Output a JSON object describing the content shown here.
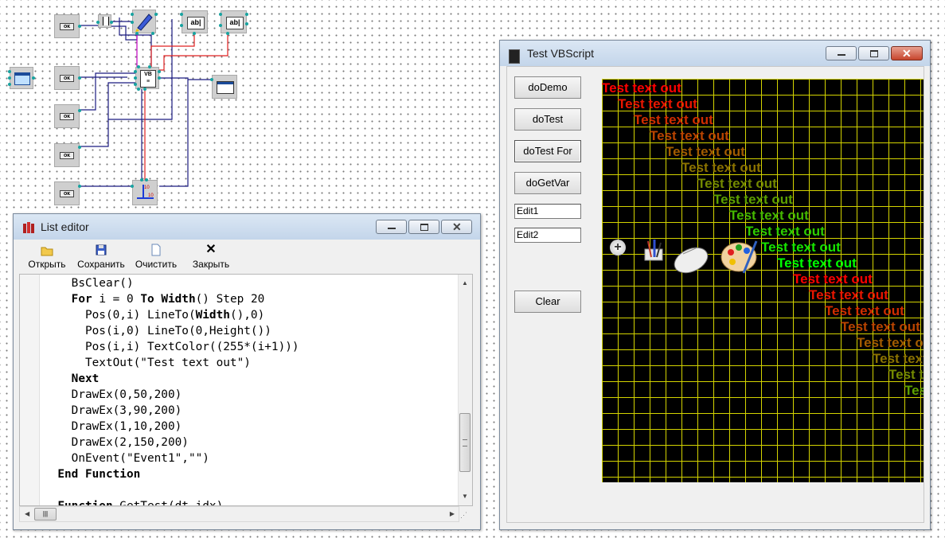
{
  "schematic": {
    "ok_label": "OK",
    "vb_label": "VB"
  },
  "list_editor": {
    "title": "List editor",
    "toolbar": {
      "open": "Открыть",
      "save": "Сохранить",
      "clear": "Очистить",
      "close": "Закрыть"
    },
    "code_lines": [
      {
        "indent": "    ",
        "parts": [
          {
            "t": "BsClear()",
            "b": false
          }
        ]
      },
      {
        "indent": "    ",
        "parts": [
          {
            "t": "For",
            "b": true
          },
          {
            "t": " i = 0 ",
            "b": false
          },
          {
            "t": "To",
            "b": true
          },
          {
            "t": " ",
            "b": false
          },
          {
            "t": "Width",
            "b": true
          },
          {
            "t": "() Step 20",
            "b": false
          }
        ]
      },
      {
        "indent": "      ",
        "parts": [
          {
            "t": "Pos(0,i) LineTo(",
            "b": false
          },
          {
            "t": "Width",
            "b": true
          },
          {
            "t": "(),0)",
            "b": false
          }
        ]
      },
      {
        "indent": "      ",
        "parts": [
          {
            "t": "Pos(i,0) LineTo(0,Height())",
            "b": false
          }
        ]
      },
      {
        "indent": "      ",
        "parts": [
          {
            "t": "Pos(i,i) TextColor((255*(i+1)))",
            "b": false
          }
        ]
      },
      {
        "indent": "      ",
        "parts": [
          {
            "t": "TextOut(\"Test text out\")",
            "b": false
          }
        ]
      },
      {
        "indent": "    ",
        "parts": [
          {
            "t": "Next",
            "b": true
          }
        ]
      },
      {
        "indent": "    ",
        "parts": [
          {
            "t": "DrawEx(0,50,200)",
            "b": false
          }
        ]
      },
      {
        "indent": "    ",
        "parts": [
          {
            "t": "DrawEx(3,90,200)",
            "b": false
          }
        ]
      },
      {
        "indent": "    ",
        "parts": [
          {
            "t": "DrawEx(1,10,200)",
            "b": false
          }
        ]
      },
      {
        "indent": "    ",
        "parts": [
          {
            "t": "DrawEx(2,150,200)",
            "b": false
          }
        ]
      },
      {
        "indent": "    ",
        "parts": [
          {
            "t": "OnEvent(\"Event1\",\"\")",
            "b": false
          }
        ]
      },
      {
        "indent": "  ",
        "parts": [
          {
            "t": "End Function",
            "b": true
          }
        ]
      },
      {
        "indent": "",
        "parts": [
          {
            "t": "",
            "b": false
          }
        ]
      },
      {
        "indent": "  ",
        "parts": [
          {
            "t": "Function",
            "b": true
          },
          {
            "t": " GetTest(dt,idx)",
            "b": false
          }
        ]
      }
    ]
  },
  "vbscript_window": {
    "title": "Test VBScript",
    "buttons": {
      "do_demo": "doDemo",
      "do_test": "doTest",
      "do_test_for": "doTest For",
      "do_get_var": "doGetVar",
      "clear": "Clear"
    },
    "edit1_value": "Edit1",
    "edit2_value": "Edit2",
    "canvas": {
      "background": "#000000",
      "grid_color": "#d4d400",
      "text": "Test text out",
      "text_colors": [
        "#ff0000",
        "#e81600",
        "#d02d00",
        "#b94400",
        "#a25b00",
        "#8b7200",
        "#738900",
        "#5ca000",
        "#45b700",
        "#2ece00",
        "#17e500",
        "#00ff00",
        "#ff0000",
        "#e81600",
        "#d02d00",
        "#b94400",
        "#a25b00",
        "#8b7200",
        "#738900",
        "#5ca000"
      ],
      "icons": [
        "plus-icon",
        "tools-icon",
        "mouse-icon",
        "palette-icon"
      ]
    }
  }
}
